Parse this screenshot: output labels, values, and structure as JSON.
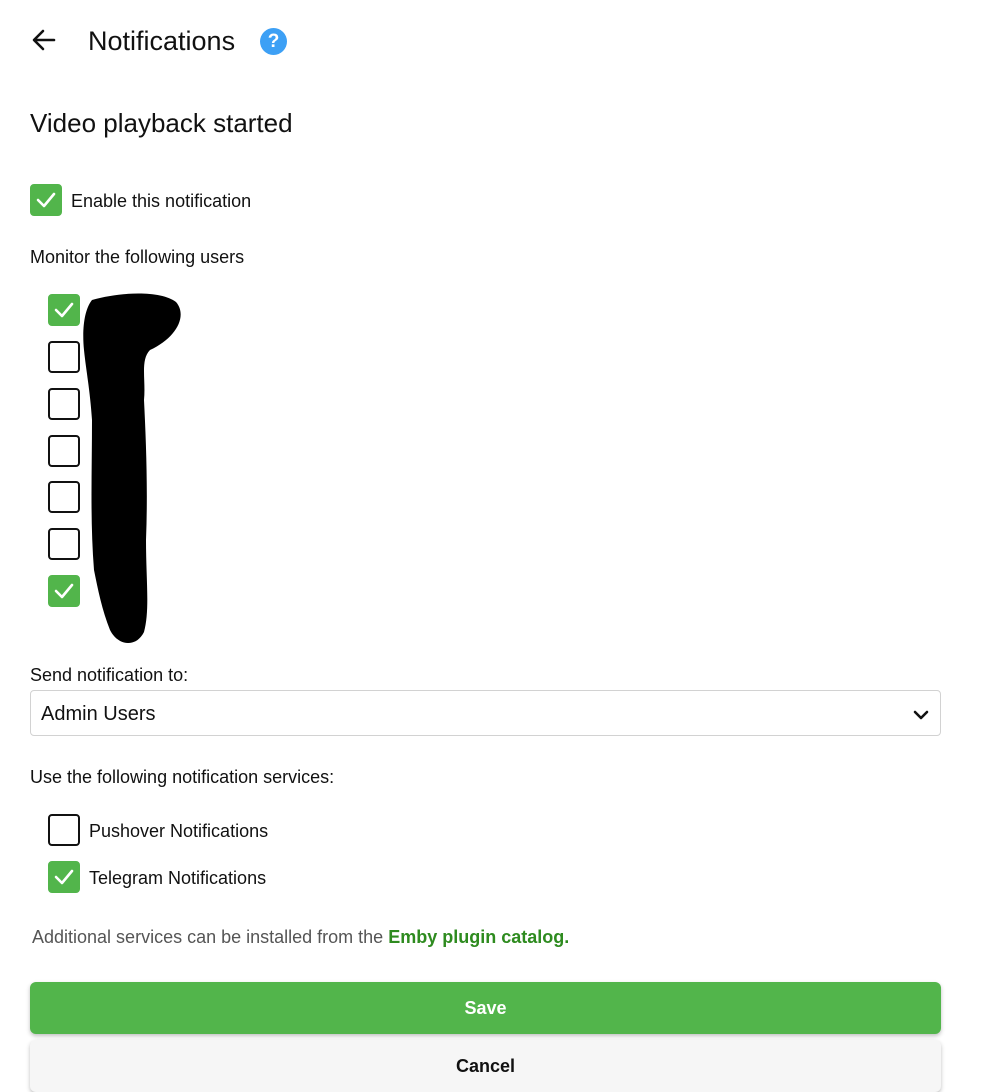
{
  "header": {
    "title": "Notifications",
    "help_glyph": "?"
  },
  "section_title": "Video playback started",
  "enable": {
    "label": "Enable this notification",
    "checked": true
  },
  "users": {
    "heading": "Monitor the following users",
    "items": [
      {
        "checked": true
      },
      {
        "checked": false
      },
      {
        "checked": false
      },
      {
        "checked": false
      },
      {
        "checked": false
      },
      {
        "checked": false
      },
      {
        "checked": true
      }
    ]
  },
  "send_to": {
    "label": "Send notification to:",
    "value": "Admin Users"
  },
  "services": {
    "heading": "Use the following notification services:",
    "items": [
      {
        "label": "Pushover Notifications",
        "checked": false
      },
      {
        "label": "Telegram Notifications",
        "checked": true
      }
    ]
  },
  "note": {
    "text": "Additional services can be installed from the ",
    "link": "Emby plugin catalog."
  },
  "buttons": {
    "save": "Save",
    "cancel": "Cancel"
  },
  "colors": {
    "accent": "#52b54b",
    "help": "#3da0f5",
    "link": "#2e8b1f"
  }
}
